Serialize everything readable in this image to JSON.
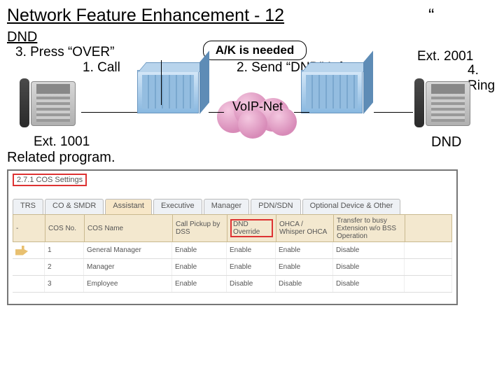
{
  "title": "Network Feature Enhancement - 12",
  "quote_mark": "“",
  "diagram": {
    "dnd_label": "DND",
    "step3": "3. Press “OVER”",
    "step1": "1. Call",
    "ak_box": "A/K is needed",
    "step2": "2. Send “DND” Info.",
    "ext2001": "Ext. 2001",
    "step4": "4. Ring",
    "cloud_label": "VoIP-Net",
    "ext1001": "Ext. 1001",
    "dnd_right": "DND"
  },
  "related_label": "Related program.",
  "panel": {
    "cos_title": "2.7.1 COS Settings",
    "tabs": [
      "TRS",
      "CO & SMDR",
      "Assistant",
      "Executive",
      "Manager",
      "PDN/SDN",
      "Optional Device & Other"
    ],
    "active_tab_index": 2,
    "headers": {
      "c0": "",
      "c1": "COS No.",
      "c2": "COS Name",
      "c3": "Call Pickup by DSS",
      "c4": "DND Override",
      "c5": "OHCA / Whisper OHCA",
      "c6": "Transfer to busy Extension w/o BSS Operation",
      "c7": ""
    },
    "rows": [
      {
        "icon": true,
        "no": "1",
        "name": "General Manager",
        "pickup": "Enable",
        "dnd": "Enable",
        "ohca": "Enable",
        "transfer": "Disable"
      },
      {
        "icon": false,
        "no": "2",
        "name": "Manager",
        "pickup": "Enable",
        "dnd": "Enable",
        "ohca": "Enable",
        "transfer": "Disable"
      },
      {
        "icon": false,
        "no": "3",
        "name": "Employee",
        "pickup": "Enable",
        "dnd": "Disable",
        "ohca": "Disable",
        "transfer": "Disable"
      }
    ]
  }
}
